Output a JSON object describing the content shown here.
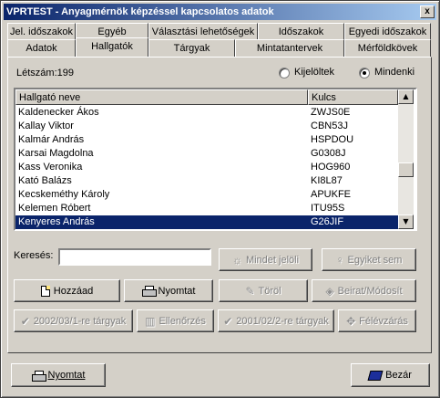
{
  "window": {
    "title": "VPRTEST - Anyagmérnök képzéssel kapcsolatos adatok",
    "close_glyph": "x"
  },
  "tabs_row1": [
    "Jel. időszakok",
    "Egyéb",
    "Választási lehetőségek",
    "Időszakok",
    "Egyedi időszakok"
  ],
  "tabs_row2": [
    "Adatok",
    "Hallgatók",
    "Tárgyak",
    "Mintatantervek",
    "Mérföldkövek"
  ],
  "active_tab": "Hallgatók",
  "count_label": "Létszám:199",
  "filter": {
    "option1": "Kijelöltek",
    "option2": "Mindenki",
    "selected": "Mindenki"
  },
  "list": {
    "columns": [
      "Hallgató neve",
      "Kulcs"
    ],
    "rows": [
      [
        "Kaldenecker Ákos",
        "ZWJS0E"
      ],
      [
        "Kallay Viktor",
        "CBN53J"
      ],
      [
        "Kalmár András",
        "HSPDOU"
      ],
      [
        "Karsai Magdolna",
        "G0308J"
      ],
      [
        "Kass Veronika",
        "HOG960"
      ],
      [
        "Kató Balázs",
        "KI8L87"
      ],
      [
        "Kecskeméthy Károly",
        "APUKFE"
      ],
      [
        "Kelemen Róbert",
        "ITU95S"
      ],
      [
        "Kenyeres András",
        "G26JIF"
      ]
    ],
    "selected_index": 8
  },
  "search": {
    "label": "Keresés:",
    "value": ""
  },
  "buttons": {
    "select_all": "Mindet jelöli",
    "select_none": "Egyiket sem",
    "add": "Hozzáad",
    "print": "Nyomtat",
    "delete": "Töröl",
    "edit": "Beirat/Módosít",
    "subjects_2002": "2002/03/1-re tárgyak",
    "check": "Ellenőrzés",
    "subjects_2001": "2001/02/2-re tárgyak",
    "semester": "Félévzárás",
    "bottom_print": "Nyomtat",
    "close": "Bezár"
  },
  "colors": {
    "title_start": "#0a246a",
    "title_end": "#a6caf0",
    "selection": "#0a246a",
    "face": "#d4d0c8"
  }
}
